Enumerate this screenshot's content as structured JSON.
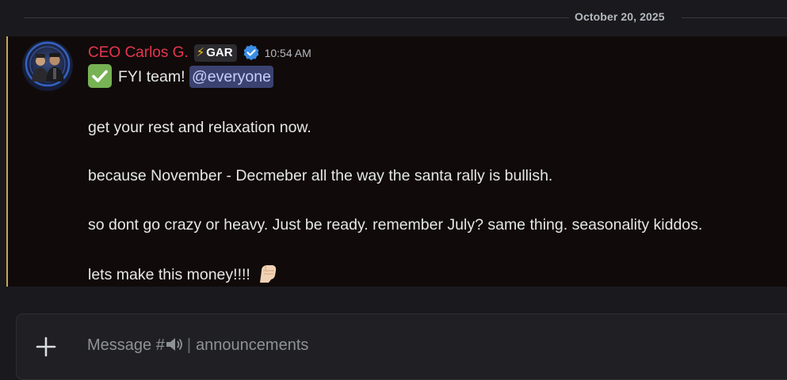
{
  "date_divider": {
    "label": "October 20, 2025"
  },
  "message": {
    "author": {
      "display_name": "CEO Carlos G.",
      "name_color": "#e8344f",
      "guild_tag": "GAR",
      "guild_tag_icon": "lightning-bolt-icon",
      "verified_icon": "verified-badge-icon",
      "avatar_icon": "avatar"
    },
    "timestamp": "10:54 AM",
    "highlight_color": "#c9a64f",
    "lines": {
      "intro_text": "FYI team!",
      "intro_emoji": "check-mark-emoji",
      "mention": "@everyone",
      "line1": "get your rest and relaxation now.",
      "line2": "because November - Decmeber all the way the santa rally is bullish.",
      "line3": "so dont go crazy or heavy. Just be ready. remember July? same thing. seasonality kiddos.",
      "line4": "lets make this money!!!!",
      "line4_emoji": "raised-fist-emoji"
    }
  },
  "composer": {
    "add_icon": "plus-icon",
    "placeholder_prefix": "Message #",
    "channel_icon": "speaker-icon",
    "separator": "|",
    "channel_name": "announcements"
  }
}
